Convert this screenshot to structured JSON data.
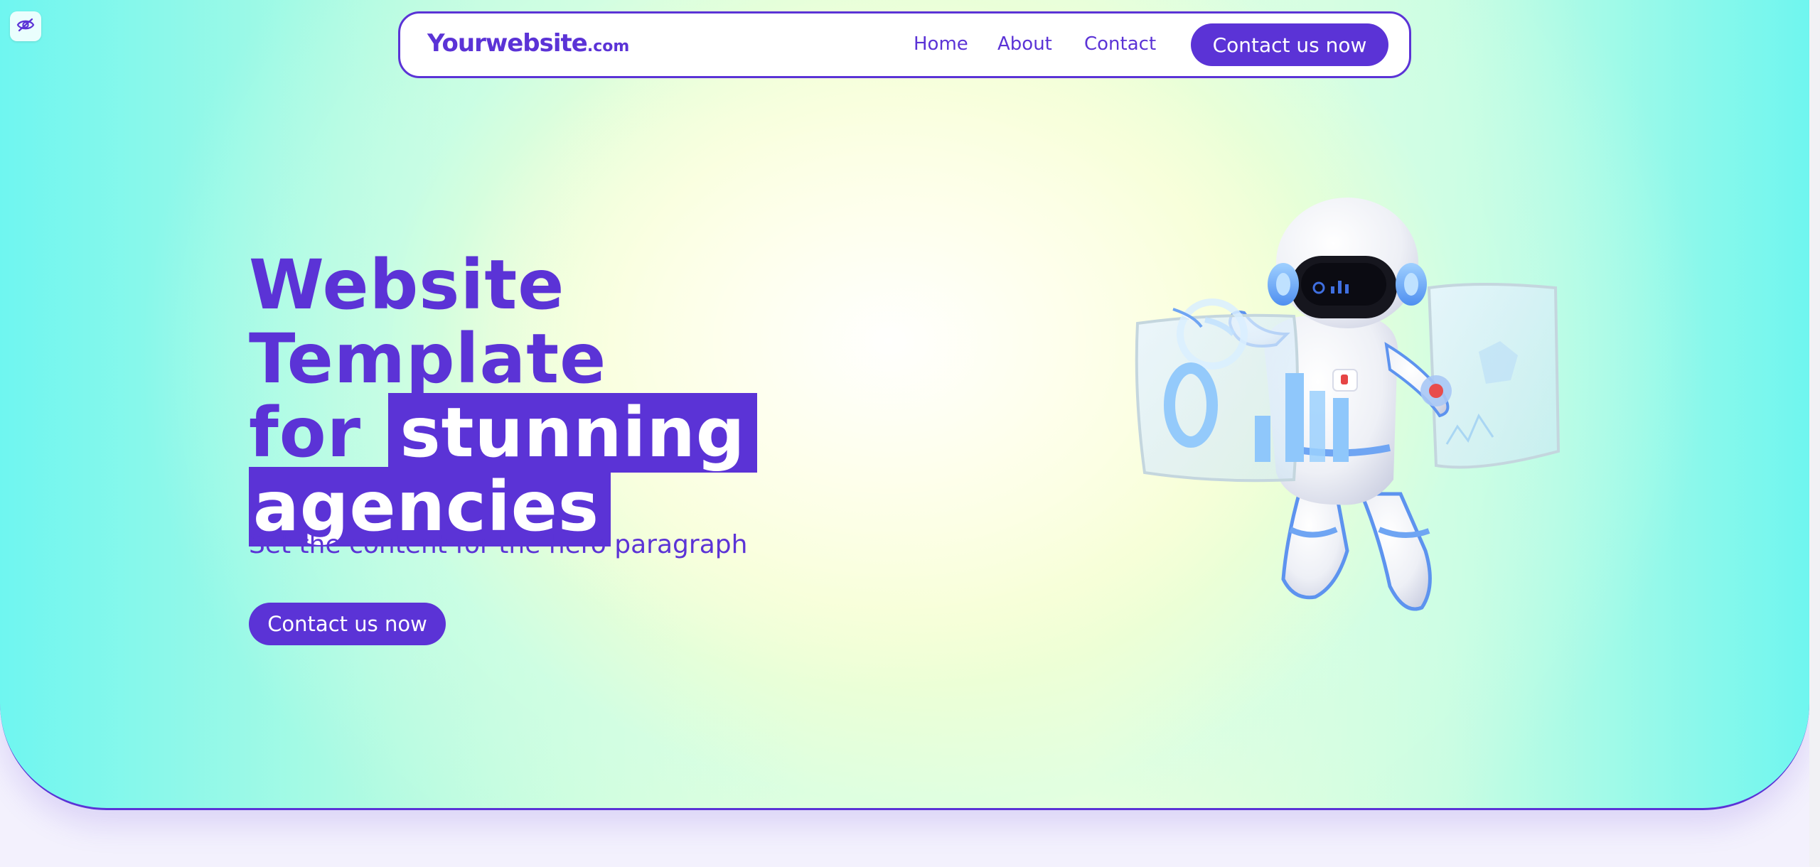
{
  "navbar": {
    "logo_main": "Yourwebsite",
    "logo_tld": ".com",
    "links": [
      {
        "label": "Home"
      },
      {
        "label": "About"
      },
      {
        "label": "Contact"
      }
    ],
    "cta_label": "Contact us now"
  },
  "hero": {
    "headline_line1": "Website Template",
    "headline_for": "for",
    "headline_highlight1": "stunning",
    "headline_highlight2": "agencies",
    "paragraph": "Set the content for the hero paragraph",
    "cta_label": "Contact us now"
  },
  "colors": {
    "brand": "#5b33d6",
    "gradient_edge": "#6ff6f0",
    "gradient_center": "#faffd8"
  },
  "icons": {
    "corner_button": "eye-slash-icon",
    "illustration": "astronaut-robot-illustration"
  }
}
